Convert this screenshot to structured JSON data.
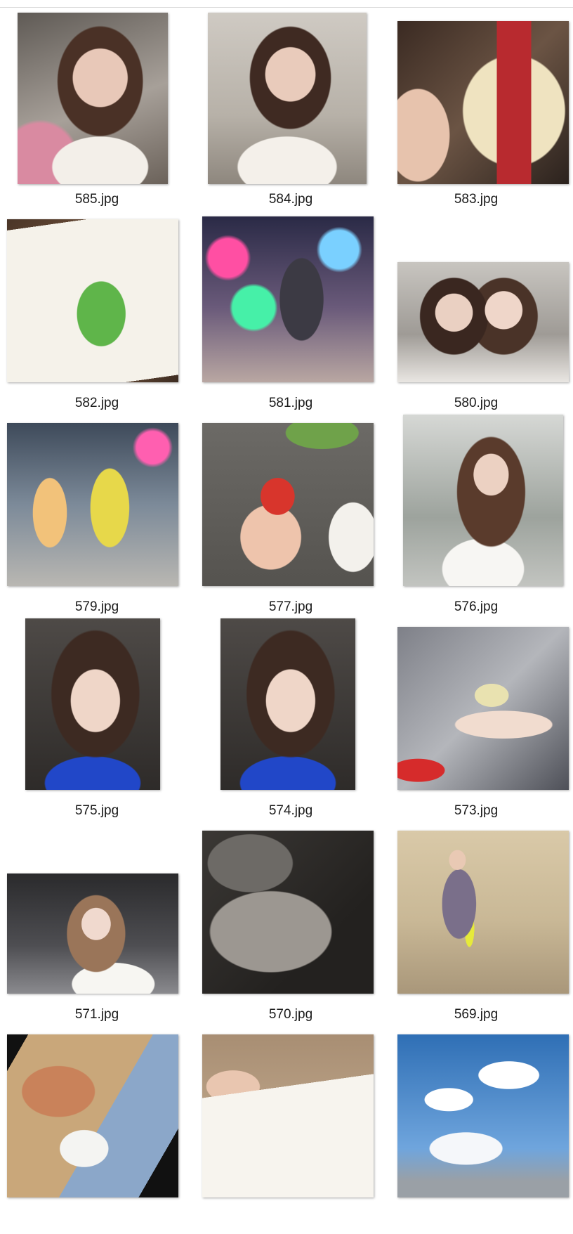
{
  "files": [
    {
      "name": "585.jpg"
    },
    {
      "name": "584.jpg"
    },
    {
      "name": "583.jpg"
    },
    {
      "name": "582.jpg"
    },
    {
      "name": "581.jpg"
    },
    {
      "name": "580.jpg"
    },
    {
      "name": "579.jpg"
    },
    {
      "name": "577.jpg"
    },
    {
      "name": "576.jpg"
    },
    {
      "name": "575.jpg"
    },
    {
      "name": "574.jpg"
    },
    {
      "name": "573.jpg"
    },
    {
      "name": "571.jpg"
    },
    {
      "name": "570.jpg"
    },
    {
      "name": "569.jpg"
    },
    {
      "name": "",
      "thumbnail": "cartoon-bears-phone-screen"
    },
    {
      "name": "",
      "thumbnail": "movie-tickets-in-hand"
    },
    {
      "name": "",
      "thumbnail": "blue-sky-clouds"
    }
  ]
}
